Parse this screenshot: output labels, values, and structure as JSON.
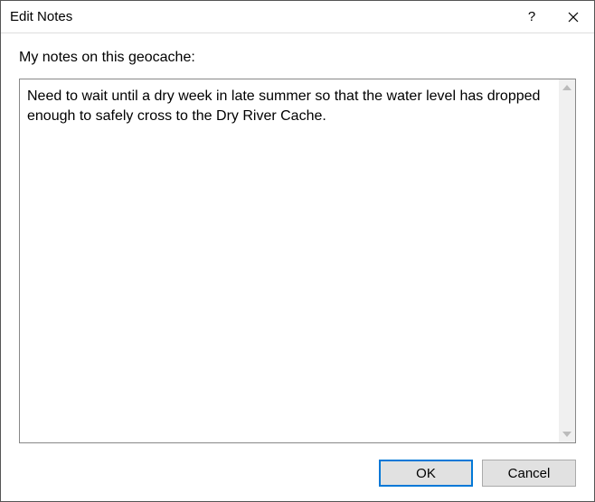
{
  "titlebar": {
    "title": "Edit Notes",
    "help_icon": "help-icon",
    "close_icon": "close-icon"
  },
  "content": {
    "label": "My notes on this geocache:",
    "notes_value": "Need to wait until a dry week in late summer so that the water level has dropped enough to safely cross to the Dry River Cache."
  },
  "buttons": {
    "ok_label": "OK",
    "cancel_label": "Cancel"
  }
}
